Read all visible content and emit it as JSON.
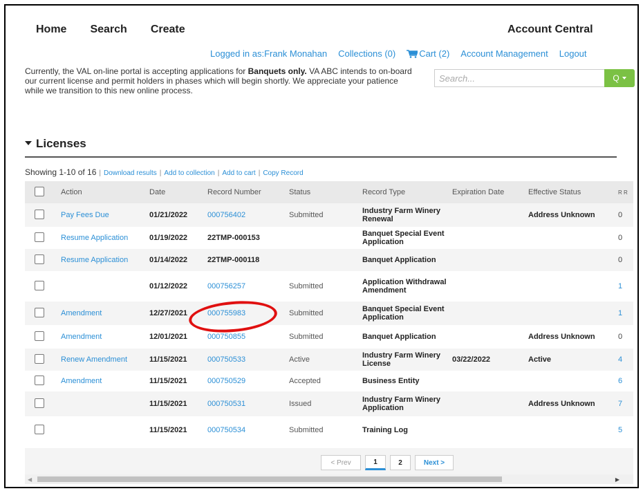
{
  "nav": {
    "home": "Home",
    "search": "Search",
    "create": "Create",
    "account_central": "Account Central"
  },
  "userbar": {
    "logged_in": "Logged in as:Frank Monahan",
    "collections": "Collections (0)",
    "cart": "Cart (2)",
    "account_management": "Account Management",
    "logout": "Logout"
  },
  "notice": {
    "part1": "Currently, the VAL on-line portal is accepting applications for ",
    "bold": "Banquets only.",
    "part2": "  VA ABC intends to on-board our current license and permit holders in phases which will begin shortly.  We appreciate your patience while we transition to this new online process."
  },
  "search": {
    "placeholder": "Search...",
    "go": "Q"
  },
  "licenses": {
    "title": "Licenses"
  },
  "toolbar": {
    "showing": "Showing 1-10 of 16",
    "download": "Download results",
    "collection": "Add to collection",
    "cart": "Add to cart",
    "copy": "Copy Record"
  },
  "table": {
    "headers": [
      "",
      "Action",
      "Date",
      "Record Number",
      "Status",
      "Record Type",
      "Expiration Date",
      "Effective Status",
      "R R"
    ],
    "rows": [
      {
        "action": "Pay Fees Due",
        "date": "01/21/2022",
        "record": "000756402",
        "status": "Submitted",
        "type": "Industry Farm Winery Renewal",
        "exp": "",
        "eff": "Address Unknown",
        "r": "0"
      },
      {
        "action": "Resume Application",
        "date": "01/19/2022",
        "record": "22TMP-000153",
        "status": "",
        "type": "Banquet Special Event Application",
        "exp": "",
        "eff": "",
        "r": "0"
      },
      {
        "action": "Resume Application",
        "date": "01/14/2022",
        "record": "22TMP-000118",
        "status": "",
        "type": "Banquet Application",
        "exp": "",
        "eff": "",
        "r": "0"
      },
      {
        "action": "",
        "date": "01/12/2022",
        "record": "000756257",
        "status": "Submitted",
        "type": "Application Withdrawal Amendment",
        "exp": "",
        "eff": "",
        "r": "1"
      },
      {
        "action": "Amendment",
        "date": "12/27/2021",
        "record": "000755983",
        "status": "Submitted",
        "type": "Banquet Special Event Application",
        "exp": "",
        "eff": "",
        "r": "1"
      },
      {
        "action": "Amendment",
        "date": "12/01/2021",
        "record": "000750855",
        "status": "Submitted",
        "type": "Banquet Application",
        "exp": "",
        "eff": "Address Unknown",
        "r": "0"
      },
      {
        "action": "Renew Amendment",
        "date": "11/15/2021",
        "record": "000750533",
        "status": "Active",
        "type": "Industry Farm Winery License",
        "exp": "03/22/2022",
        "eff": "Active",
        "r": "4"
      },
      {
        "action": "Amendment",
        "date": "11/15/2021",
        "record": "000750529",
        "status": "Accepted",
        "type": "Business Entity",
        "exp": "",
        "eff": "",
        "r": "6"
      },
      {
        "action": "",
        "date": "11/15/2021",
        "record": "000750531",
        "status": "Issued",
        "type": "Industry Farm Winery Application",
        "exp": "",
        "eff": "Address Unknown",
        "r": "7"
      },
      {
        "action": "",
        "date": "11/15/2021",
        "record": "000750534",
        "status": "Submitted",
        "type": "Training Log",
        "exp": "",
        "eff": "",
        "r": "5"
      }
    ]
  },
  "pager": {
    "prev": "< Prev",
    "p1": "1",
    "p2": "2",
    "next": "Next >"
  },
  "colors": {
    "link": "#2b8fd6",
    "go_button": "#7bc144",
    "highlight_circle": "#e01010"
  }
}
